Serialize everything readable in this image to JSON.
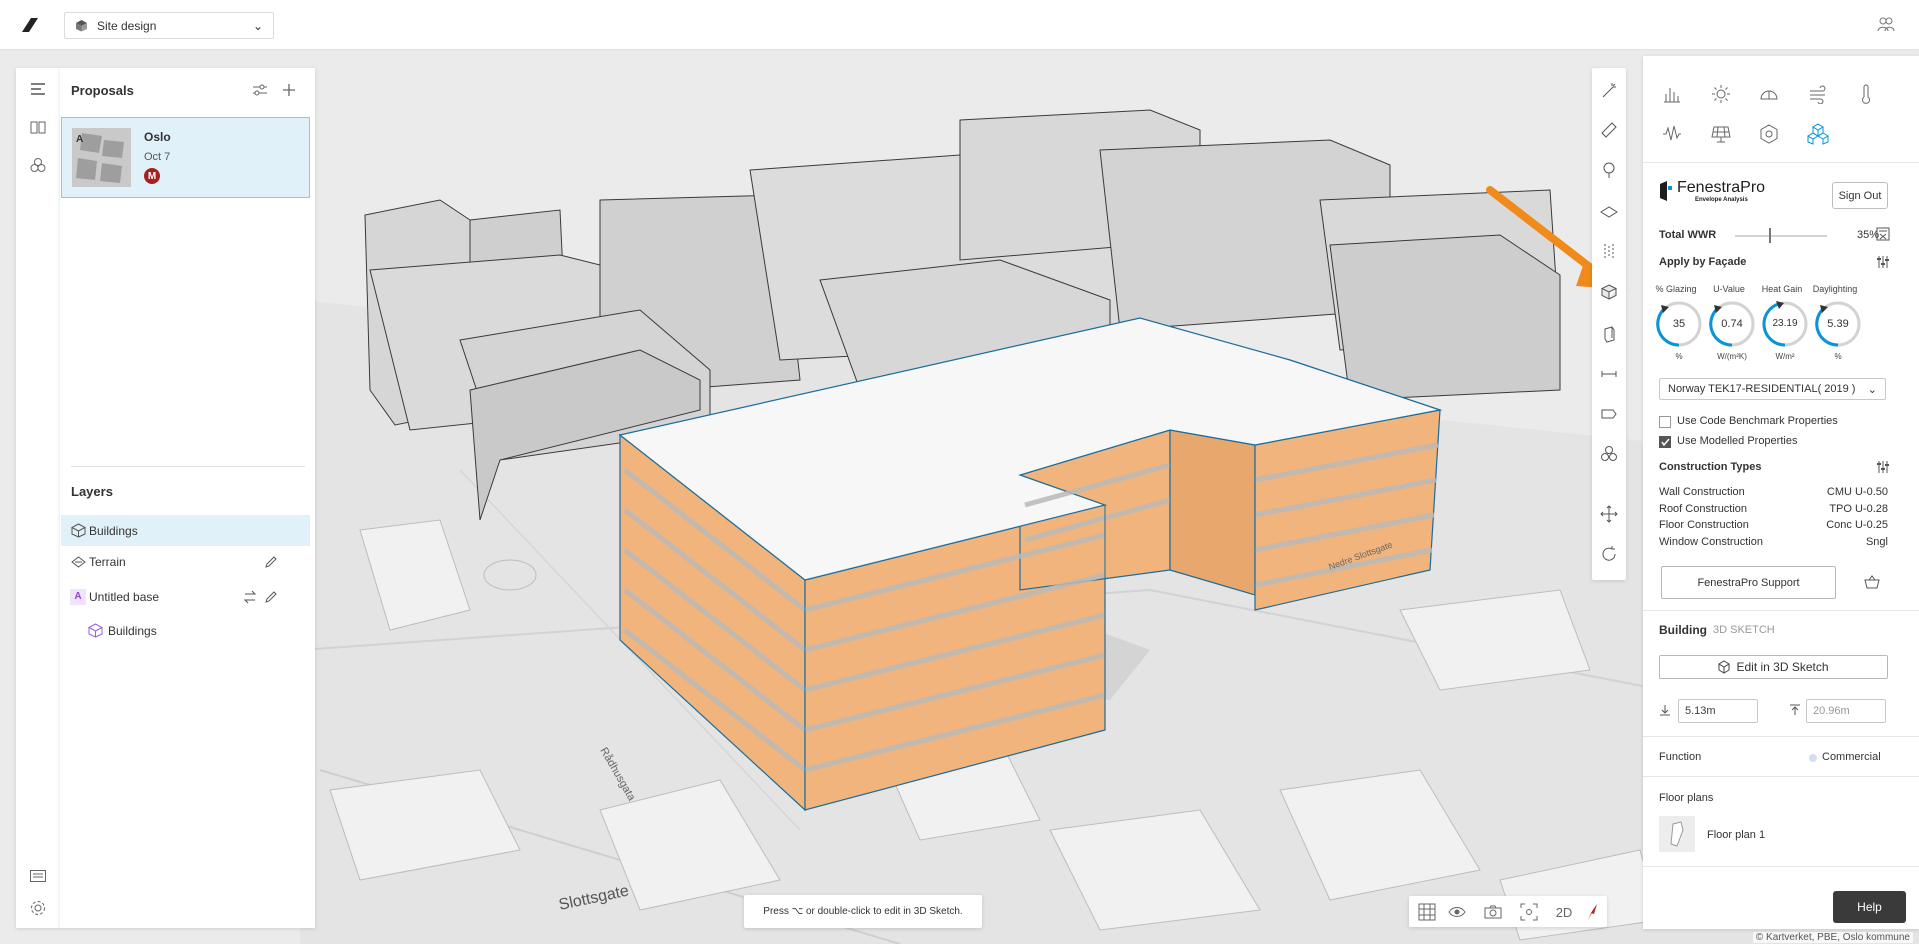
{
  "topbar": {
    "site_name": "Site design"
  },
  "proposals": {
    "title": "Proposals",
    "card": {
      "name": "Oslo",
      "date": "Oct 7",
      "avatar_initial": "M",
      "thumb_letter": "A"
    }
  },
  "layers": {
    "title": "Layers",
    "items": [
      {
        "label": "Buildings"
      },
      {
        "label": "Terrain"
      },
      {
        "label": "Untitled base",
        "badge": "A"
      },
      {
        "label": "Buildings"
      }
    ]
  },
  "map_labels": {
    "slottsgate": "Slottsgate",
    "radhusgata": "Rådhusgata",
    "street2": "Nedre Slottsgate"
  },
  "fenestra": {
    "brand": "FenestraPro",
    "tagline": "Envelope Analysis",
    "sign_out": "Sign Out",
    "total_wwr_label": "Total WWR",
    "total_wwr_value": "35%",
    "apply_label": "Apply by Façade",
    "gauges": [
      {
        "label": "% Glazing",
        "value": "35",
        "unit": "%"
      },
      {
        "label": "U-Value",
        "value": "0.74",
        "unit": "W/(m²K)"
      },
      {
        "label": "Heat Gain",
        "value": "23.19",
        "unit": "W/m²"
      },
      {
        "label": "Daylighting",
        "value": "5.39",
        "unit": "%"
      }
    ],
    "code_dropdown": "Norway TEK17-RESIDENTIAL( 2019 )",
    "use_code_label": "Use Code Benchmark Properties",
    "use_code_checked": false,
    "use_modelled_label": "Use Modelled Properties",
    "use_modelled_checked": true,
    "construction_title": "Construction Types",
    "constructions": [
      {
        "label": "Wall Construction",
        "value": "CMU U-0.50"
      },
      {
        "label": "Roof Construction",
        "value": "TPO U-0.28"
      },
      {
        "label": "Floor Construction",
        "value": "Conc U-0.25"
      },
      {
        "label": "Window Construction",
        "value": "Sngl"
      }
    ],
    "support_button": "FenestraPro Support"
  },
  "building": {
    "title": "Building",
    "subtitle": "3D SKETCH",
    "edit_button": "Edit in 3D Sketch",
    "base_height": "5.13m",
    "top_height": "20.96m",
    "function_label": "Function",
    "function_value": "Commercial",
    "floor_plans_title": "Floor plans",
    "floor_plan_item": "Floor plan 1"
  },
  "help": "Help",
  "toast": "Press ⌥ or double-click to edit in 3D Sketch.",
  "view_mode": "2D",
  "attribution": "© Kartverket, PBE, Oslo kommune",
  "colors": {
    "accent_blue": "#0696d7",
    "highlight_orange": "#ef8a1b",
    "facade_orange": "#f0b47c",
    "avatar_red": "#a52020"
  }
}
